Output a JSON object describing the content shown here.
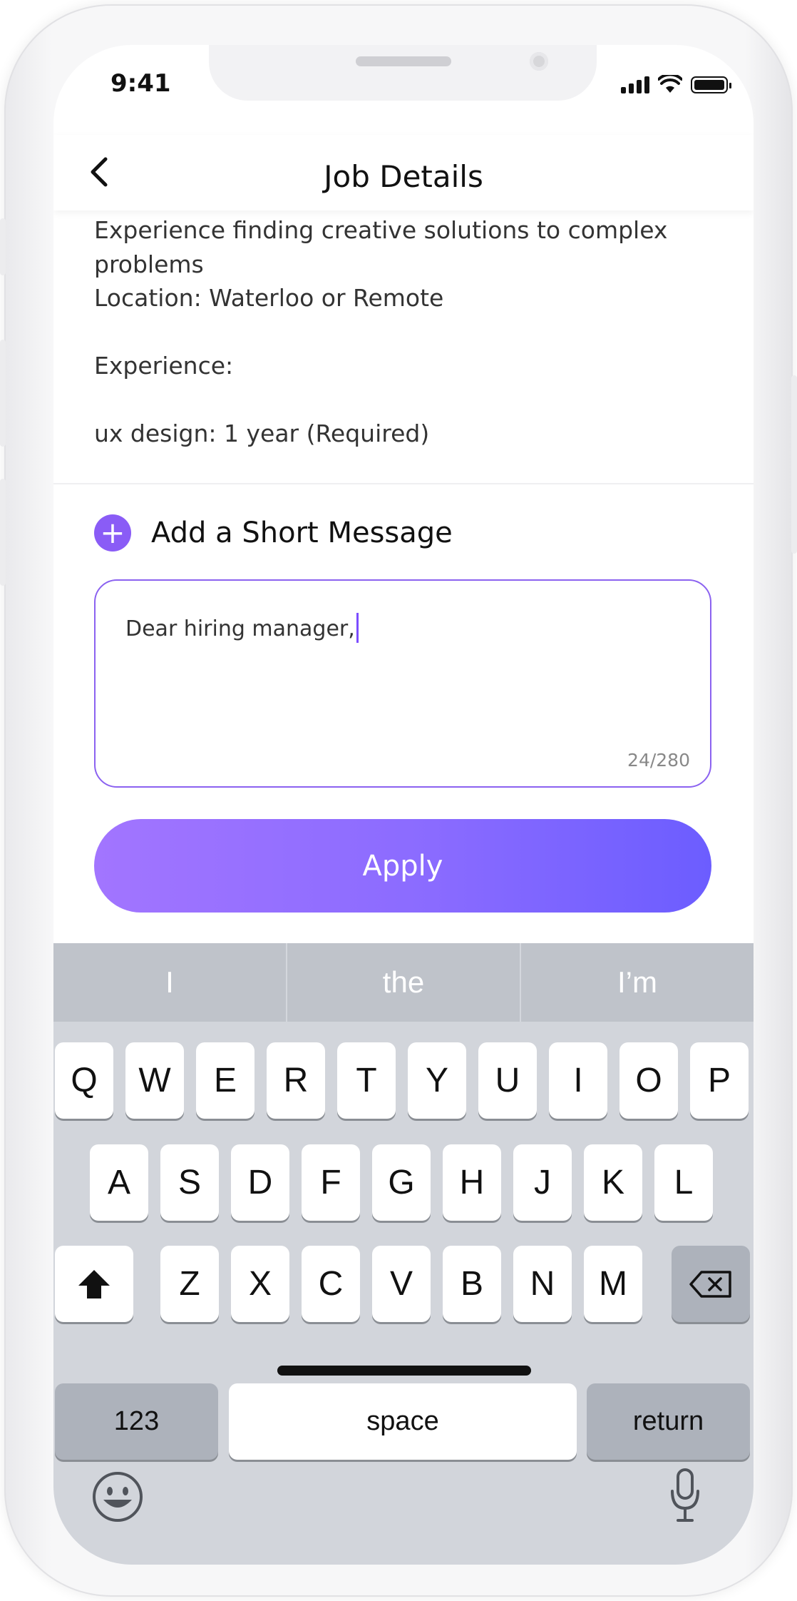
{
  "status_bar": {
    "time": "9:41"
  },
  "header": {
    "title": "Job Details",
    "back_icon": "chevron-left-icon"
  },
  "description": {
    "lines": [
      "Experience finding creative solutions to complex",
      "problems",
      "Location: Waterloo or Remote",
      "",
      "Experience:",
      "",
      "ux design: 1 year (Required)"
    ]
  },
  "message": {
    "label": "Add a Short Message",
    "value": "Dear hiring manager,",
    "counter": "24/280"
  },
  "apply_label": "Apply",
  "colors": {
    "accent": "#8a5cf6",
    "apply_gradient_start": "#a275ff",
    "apply_gradient_end": "#6c5dff"
  },
  "keyboard": {
    "suggestions": [
      "I",
      "the",
      "I’m"
    ],
    "row1": [
      "Q",
      "W",
      "E",
      "R",
      "T",
      "Y",
      "U",
      "I",
      "O",
      "P"
    ],
    "row2": [
      "A",
      "S",
      "D",
      "F",
      "G",
      "H",
      "J",
      "K",
      "L"
    ],
    "row3": [
      "Z",
      "X",
      "C",
      "V",
      "B",
      "N",
      "M"
    ],
    "numbers_label": "123",
    "space_label": "space",
    "return_label": "return"
  }
}
